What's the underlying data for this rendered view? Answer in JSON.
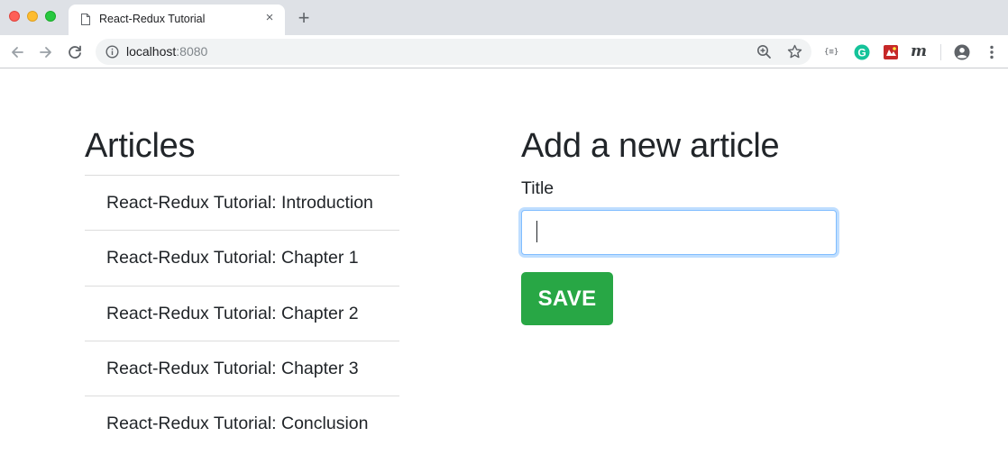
{
  "browser": {
    "tab": {
      "title": "React-Redux Tutorial",
      "close_glyph": "×"
    },
    "new_tab_glyph": "+",
    "url": {
      "host": "localhost",
      "port": ":8080"
    },
    "icons": {
      "back": "back-arrow-icon",
      "forward": "forward-arrow-icon",
      "reload": "reload-icon",
      "info": "info-icon",
      "zoom": "zoom-icon",
      "bookmark": "star-icon",
      "ext_json": "json-viewer-icon",
      "ext_grammarly": "grammarly-icon",
      "ext_red": "extension-icon",
      "ext_m": "m-extension-icon",
      "profile": "profile-icon",
      "menu": "kebab-menu-icon"
    },
    "extension_labels": {
      "json": "{≡}",
      "grammarly": "G",
      "m": "m"
    },
    "colors": {
      "grammarly": "#15c39a",
      "tabbar": "#dee1e6"
    }
  },
  "articles": {
    "heading": "Articles",
    "items": [
      "React-Redux Tutorial: Introduction",
      "React-Redux Tutorial: Chapter 1",
      "React-Redux Tutorial: Chapter 2",
      "React-Redux Tutorial: Chapter 3",
      "React-Redux Tutorial: Conclusion"
    ]
  },
  "form": {
    "heading": "Add a new article",
    "title_label": "Title",
    "title_value": "",
    "save_label": "SAVE",
    "colors": {
      "save_button": "#28a745",
      "focus_border": "#80bdff"
    }
  }
}
